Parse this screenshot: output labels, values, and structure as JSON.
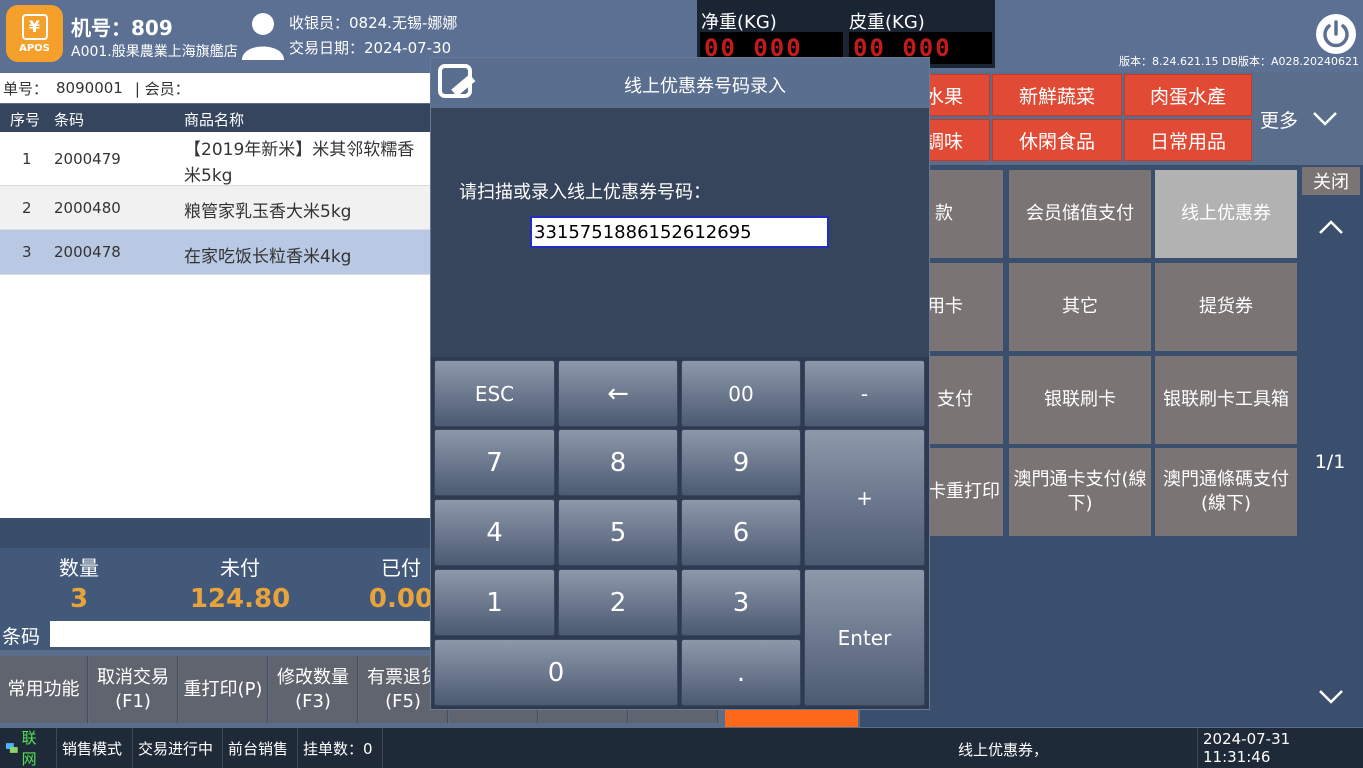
{
  "header": {
    "logo_text": "APOS",
    "logo_symbol": "¥",
    "machine_no": "机号：809",
    "store_name": "A001.般果農業上海旗艦店",
    "cashier": "收银员：0824.无锡-娜娜",
    "trade_date": "交易日期：2024-07-30",
    "net_weight_label": "净重(KG)",
    "net_weight_value": "00 000",
    "tare_weight_label": "皮重(KG)",
    "tare_weight_value": "00 000",
    "version": "版本：8.24.621.15 DB版本：A028.20240621"
  },
  "order": {
    "order_no_label": "单号：",
    "order_no": "8090001",
    "member_label": "| 会员：",
    "columns": [
      "序号",
      "条码",
      "商品名称"
    ],
    "items": [
      {
        "seq": "1",
        "barcode": "2000479",
        "name": "【2019年新米】米其邻软糯香",
        "name2": "米5kg"
      },
      {
        "seq": "2",
        "barcode": "2000480",
        "name": "粮管家乳玉香大米5kg",
        "name2": ""
      },
      {
        "seq": "3",
        "barcode": "2000478",
        "name": "在家吃饭长粒香米4kg",
        "name2": ""
      }
    ]
  },
  "totals": {
    "qty_label": "数量",
    "qty": "3",
    "unpaid_label": "未付",
    "unpaid": "124.80",
    "paid_label": "已付",
    "paid": "0.00"
  },
  "barcode": {
    "label": "条码"
  },
  "functions": [
    {
      "l1": "常用功能",
      "l2": ""
    },
    {
      "l1": "取消交易",
      "l2": "(F1)"
    },
    {
      "l1": "重打印(P)",
      "l2": ""
    },
    {
      "l1": "修改数量",
      "l2": "(F3)"
    },
    {
      "l1": "有票退货",
      "l2": "(F5)"
    }
  ],
  "categories": [
    "水果",
    "新鮮蔬菜",
    "肉蛋水產",
    "調味",
    "休閑食品",
    "日常用品"
  ],
  "more_label": "更多",
  "payments": [
    "款",
    "会员储值支付",
    "线上优惠券",
    "用卡",
    "其它",
    "提货券",
    "支付",
    "银联刷卡",
    "银联刷卡工具箱",
    "卡重打印",
    "澳門通卡支付(線下)",
    "澳門通條碼支付(線下)"
  ],
  "side": {
    "close": "关闭",
    "page": "1/1"
  },
  "status": {
    "net": "联网",
    "mode": "销售模式",
    "state": "交易进行中",
    "front": "前台销售",
    "hold": "挂单数：0",
    "message": "线上优惠券，",
    "datetime": "2024-07-31 11:31:46"
  },
  "dialog": {
    "title": "线上优惠券号码录入",
    "prompt": "请扫描或录入线上优惠券号码：",
    "input_value": "3315751886152612695",
    "keys": {
      "esc": "ESC",
      "back": "←",
      "dbl0": "00",
      "minus": "-",
      "k7": "7",
      "k8": "8",
      "k9": "9",
      "plus": "+",
      "k4": "4",
      "k5": "5",
      "k6": "6",
      "k1": "1",
      "k2": "2",
      "k3": "3",
      "enter": "Enter",
      "k0": "0",
      "dot": "."
    }
  },
  "colors": {
    "header_bg": "#5b7093",
    "accent_orange": "#e8a33a",
    "category_red": "#e14b36",
    "logo_orange": "#f5a02a"
  }
}
